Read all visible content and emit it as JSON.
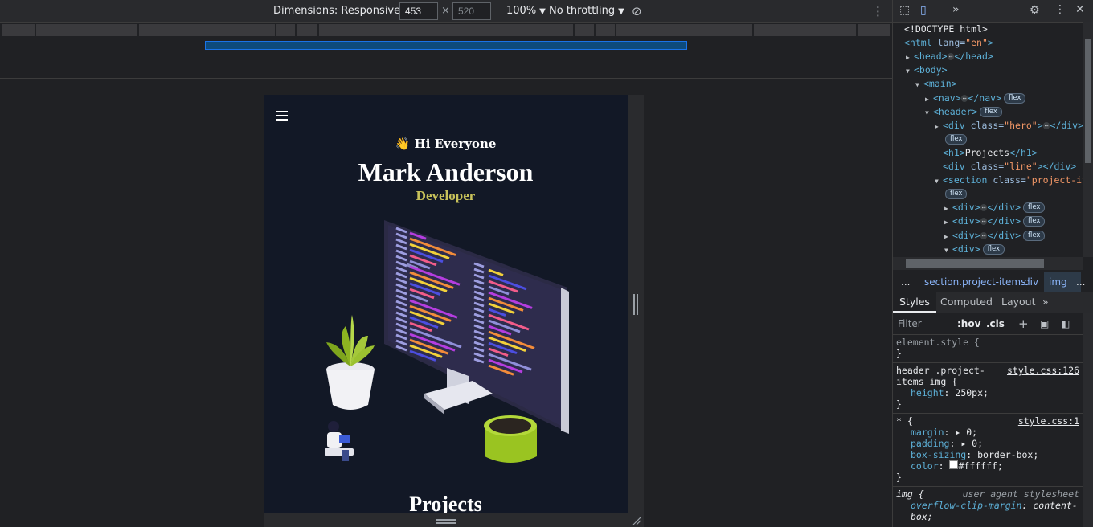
{
  "device_toolbar": {
    "dimensions_label": "Dimensions: Responsive",
    "width_value": "453",
    "times_sign": "×",
    "height_placeholder": "520",
    "zoom": "100%",
    "throttling": "No throttling"
  },
  "page": {
    "greeting_emoji": "👋",
    "greeting": "Hi Everyone",
    "name": "Mark Anderson",
    "role": "Developer",
    "section_title": "Projects"
  },
  "devtools": {
    "tree": [
      {
        "text_doctype": "<!DOCTYPE html>"
      },
      {
        "tag_open": "<html",
        "attr": " lang=",
        "val": "\"en\"",
        "tag_close": ">"
      },
      {
        "tag": "<head>",
        "tag_end": "</head>"
      },
      {
        "tag": "<body>"
      },
      {
        "tag": "<main>"
      },
      {
        "tag": "<nav>",
        "tag_end": "</nav>",
        "badge": "flex"
      },
      {
        "tag": "<header>",
        "badge": "flex"
      },
      {
        "tag_open": "<div",
        "attr": " class=",
        "val": "\"hero\"",
        "tag_close": ">",
        "tag_end": "</div>"
      },
      {
        "badge": "flex"
      },
      {
        "tag_open": "<h1>",
        "text": "Projects",
        "tag_end": "</h1>"
      },
      {
        "tag_open": "<div",
        "attr": " class=",
        "val": "\"line\"",
        "tag_close": "></div>"
      },
      {
        "tag_open": "<section",
        "attr": " class=",
        "val": "\"project-it"
      },
      {
        "badge": "flex"
      },
      {
        "tag": "<div>",
        "tag_end": "</div>",
        "badge": "flex"
      },
      {
        "tag": "<div>",
        "tag_end": "</div>",
        "badge": "flex"
      },
      {
        "tag": "<div>",
        "tag_end": "</div>",
        "badge": "flex"
      },
      {
        "tag": "<div>",
        "badge": "flex"
      }
    ],
    "breadcrumbs": [
      "...",
      "section.project-items",
      "div",
      "img",
      "..."
    ],
    "tabs": [
      "Styles",
      "Computed",
      "Layout"
    ],
    "filter_placeholder": "Filter",
    "hov": ":hov",
    "cls": ".cls",
    "styles": {
      "element_style": "element.style {",
      "close_brace": "}",
      "rule1_selector": "header .project-items img {",
      "rule1_link": "style.css:126",
      "rule1_prop": "height",
      "rule1_value": "250px;",
      "rule2_selector": "* {",
      "rule2_link": "style.css:1",
      "margin_prop": "margin",
      "margin_value": "0;",
      "padding_prop": "padding",
      "padding_value": "0;",
      "boxsizing_prop": "box-sizing",
      "boxsizing_value": "border-box;",
      "color_prop": "color",
      "color_value": "#ffffff;",
      "rule3_selector": "img {",
      "rule3_source": "user agent stylesheet",
      "overflow_prop": "overflow-clip-margin",
      "overflow_value": "content-box;"
    }
  },
  "colors": {
    "page_bg": "#121826",
    "role_color": "#c8c25a",
    "accent_blue": "#1a73e8"
  }
}
